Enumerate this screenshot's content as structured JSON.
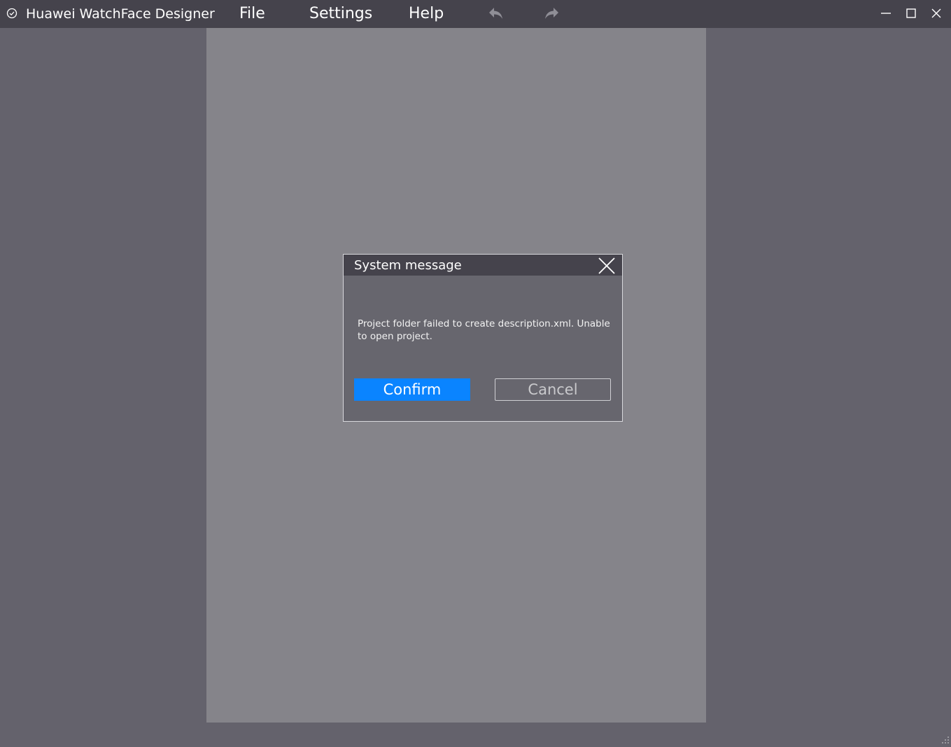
{
  "window": {
    "title": "Huawei WatchFace Designer",
    "icon": "clock-check-icon"
  },
  "menu": {
    "file": "File",
    "settings": "Settings",
    "help": "Help"
  },
  "toolbar": {
    "undo_icon": "undo-icon",
    "redo_icon": "redo-icon"
  },
  "window_controls": {
    "minimize_icon": "minimize-icon",
    "maximize_icon": "maximize-icon",
    "close_icon": "close-icon"
  },
  "dialog": {
    "title": "System message",
    "message": "Project folder failed to create description.xml. Unable to open project.",
    "confirm_label": "Confirm",
    "cancel_label": "Cancel",
    "close_icon": "close-icon"
  },
  "colors": {
    "titlebar": "#45434c",
    "background": "#64626c",
    "canvas": "#85848a",
    "dialog": "#67666e",
    "accent": "#0a84ff"
  }
}
